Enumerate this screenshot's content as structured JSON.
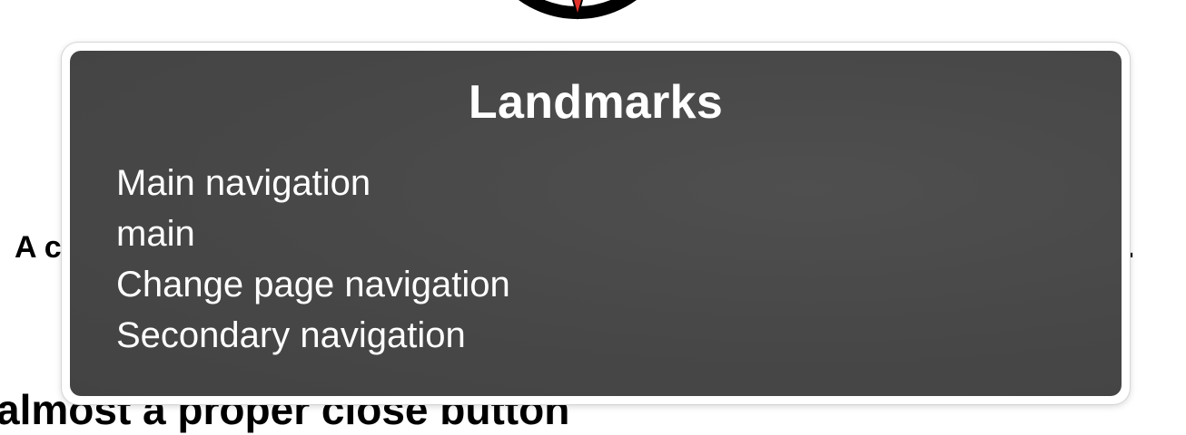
{
  "background": {
    "line_1_start": "A c",
    "line_1_end": ".",
    "heading": "almost a proper close button"
  },
  "rotor": {
    "title": "Landmarks",
    "items": [
      {
        "label": "Main navigation"
      },
      {
        "label": "main"
      },
      {
        "label": "Change page navigation"
      },
      {
        "label": "Secondary navigation"
      }
    ]
  },
  "colors": {
    "panel_bg": "#474747",
    "panel_text": "#ffffff",
    "compass_needle": "#e0312a"
  },
  "icons": {
    "logo": "compass-logo"
  }
}
